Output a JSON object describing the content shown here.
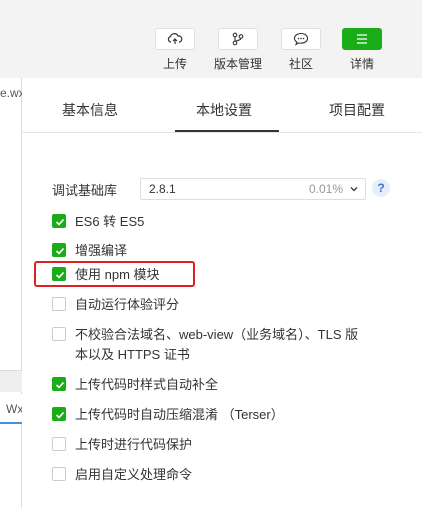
{
  "toolbar": {
    "upload_label": "上传",
    "version_label": "版本管理",
    "community_label": "社区",
    "details_label": "详情"
  },
  "editor": {
    "file_tab": "e.wx",
    "bottom_tab": "Wx"
  },
  "tabs": [
    {
      "label": "基本信息"
    },
    {
      "label": "本地设置"
    },
    {
      "label": "项目配置"
    }
  ],
  "version_row": {
    "label": "调试基础库",
    "value": "2.8.1",
    "percent": "0.01%",
    "help": "?"
  },
  "options": [
    {
      "label": "ES6 转 ES5",
      "checked": true
    },
    {
      "label": "增强编译",
      "checked": true
    },
    {
      "label": "使用 npm 模块",
      "checked": true
    },
    {
      "label": "自动运行体验评分",
      "checked": false
    },
    {
      "label_line1": "不校验合法域名、web-view（业务域名）、TLS 版",
      "label_line2": "本以及 HTTPS 证书",
      "checked": false
    },
    {
      "label": "上传代码时样式自动补全",
      "checked": true
    },
    {
      "label": "上传代码时自动压缩混淆 （Terser）",
      "checked": true
    },
    {
      "label": "上传时进行代码保护",
      "checked": false
    },
    {
      "label": "启用自定义处理命令",
      "checked": false
    }
  ],
  "colors": {
    "accent_green": "#1aad19",
    "highlight_red": "#e02020"
  }
}
